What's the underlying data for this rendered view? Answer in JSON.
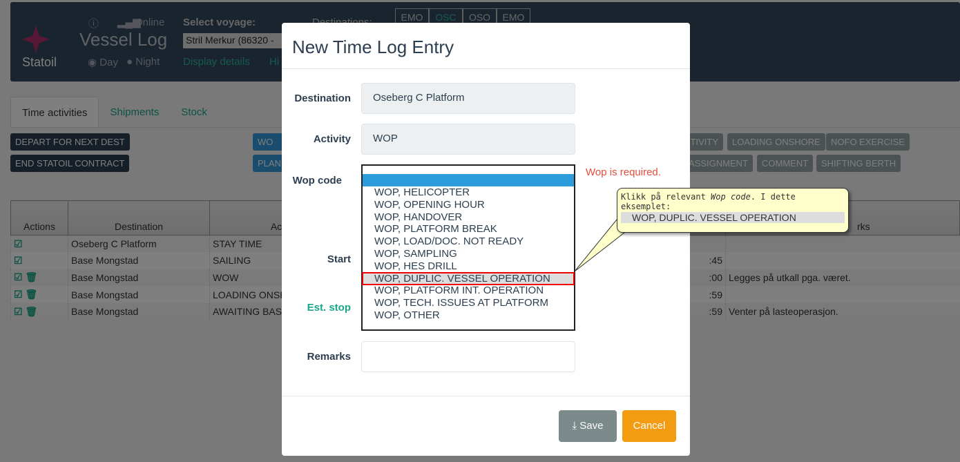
{
  "header": {
    "brand": "Statoil",
    "info_icon": "info-icon",
    "signal_icon": "signal-icon",
    "status": "Online",
    "app_title": "Vessel Log",
    "day": "Day",
    "night": "Night",
    "select_voyage_label": "Select voyage:",
    "voyage_value": "Stril Merkur (86320 -",
    "display_details": "Display details",
    "history_partial": "Hi",
    "destinations_label": "Destinations:",
    "destination_codes": [
      "EMO",
      "OSC",
      "OSO",
      "EMO"
    ]
  },
  "tabs": [
    "Time activities",
    "Shipments",
    "Stock"
  ],
  "buttons": {
    "depart": "DEPART FOR NEXT DEST",
    "end_contract": "END STATOIL CONTRACT",
    "wo": "WO",
    "plan": "PLAN",
    "activity": "TIVITY",
    "loading_onshore": "LOADING ONSHORE",
    "nofo": "NOFO EXERCISE",
    "assignment": "ASSIGNMENT",
    "comment": "COMMENT",
    "shifting": "SHIFTING BERTH"
  },
  "table": {
    "headers": [
      "Actions",
      "Destination",
      "Acti",
      "rks"
    ],
    "rows": [
      {
        "dest": "Oseberg C Platform",
        "activity": "STAY TIME",
        "time": "",
        "remarks": "",
        "delete": false
      },
      {
        "dest": "Base Mongstad",
        "activity": "SAILING",
        "time": ":45",
        "remarks": "",
        "delete": false
      },
      {
        "dest": "Base Mongstad",
        "activity": "WOW",
        "time": ":00",
        "remarks": "Legges på utkall pga. været.",
        "delete": true
      },
      {
        "dest": "Base Mongstad",
        "activity": "LOADING ONSH",
        "time": ":59",
        "remarks": "",
        "delete": true
      },
      {
        "dest": "Base Mongstad",
        "activity": "AWAITING BAS",
        "time": ":59",
        "remarks": "Venter på lasteoperasjon.",
        "delete": true
      }
    ]
  },
  "modal": {
    "title": "New Time Log Entry",
    "destination_label": "Destination",
    "destination_value": "Oseberg C Platform",
    "activity_label": "Activity",
    "activity_value": "WOP",
    "wop_label": "Wop code",
    "start_label": "Start",
    "est_stop_label": "Est. stop",
    "remarks_label": "Remarks",
    "error": "Wop is required.",
    "save": "Save",
    "cancel": "Cancel",
    "wop_options": [
      "WOP, HELICOPTER",
      "WOP, OPENING HOUR",
      "WOP, HANDOVER",
      "WOP, PLATFORM BREAK",
      "WOP, LOAD/DOC. NOT READY",
      "WOP, SAMPLING",
      "WOP, HES DRILL",
      "WOP, DUPLIC. VESSEL OPERATION",
      "WOP, PLATFORM INT. OPERATION",
      "WOP, TECH. ISSUES AT PLATFORM",
      "WOP, OTHER"
    ],
    "highlighted_option": "WOP, DUPLIC. VESSEL OPERATION"
  },
  "callout": {
    "text_pre": "Klikk på relevant ",
    "text_em": "Wop code",
    "text_post": ". I dette eksemplet:",
    "example": "WOP, DUPLIC. VESSEL OPERATION"
  }
}
